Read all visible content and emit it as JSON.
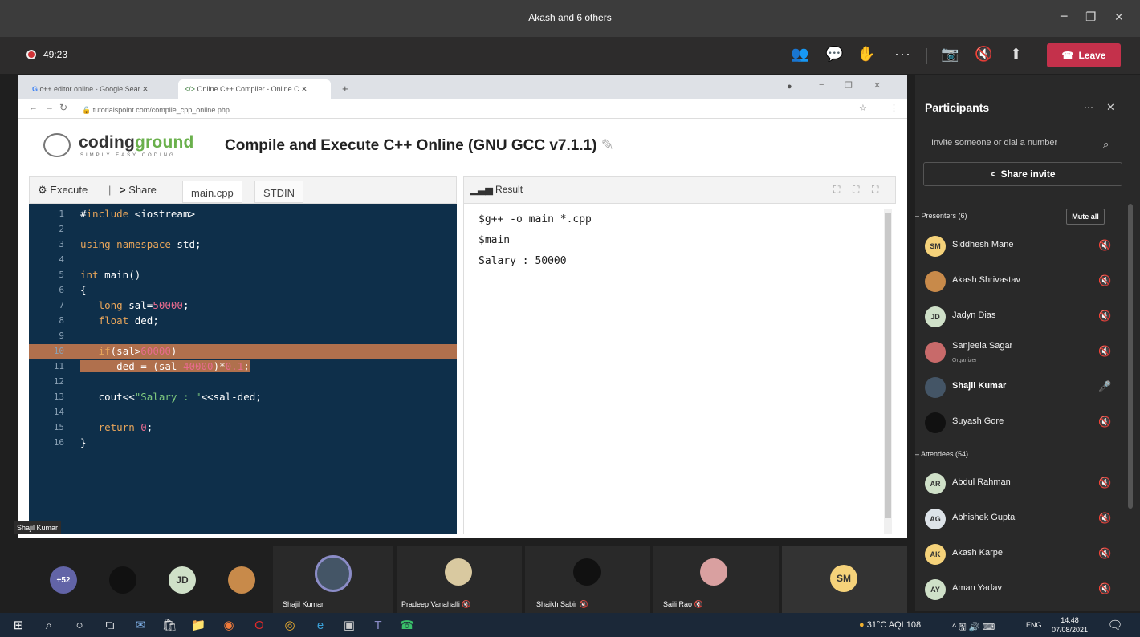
{
  "window": {
    "title": "Akash and 6 others",
    "min": "−",
    "max": "❐",
    "close": "✕"
  },
  "meeting": {
    "timer": "49:23",
    "leave_label": "Leave",
    "icons": [
      "people-icon",
      "chat-icon",
      "reactions-icon",
      "more-icon",
      "camera-off-icon",
      "mic-off-icon",
      "share-tray-icon"
    ]
  },
  "browser": {
    "tabs": [
      "c++ editor online - Google Sear",
      "Online C++ Compiler - Online C"
    ],
    "new_tab": "+",
    "url": "tutorialspoint.com/compile_cpp_online.php"
  },
  "codingground": {
    "logo_main": "coding",
    "logo_accent": "ground",
    "logo_tagline": "SIMPLY EASY CODING",
    "title": "Compile and Execute C++ Online (GNU GCC v7.1.1)",
    "execute": "Execute",
    "sep": "|",
    "share": "Share",
    "file_tab": "main.cpp",
    "stdin_tab": "STDIN",
    "result_label": "Result",
    "result_lines": [
      "$g++ -o main *.cpp",
      "$main",
      "Salary : 50000"
    ]
  },
  "code_lines": [
    {
      "n": "1",
      "t": "#include <iostream>"
    },
    {
      "n": "2",
      "t": ""
    },
    {
      "n": "3",
      "t": "using namespace std;"
    },
    {
      "n": "4",
      "t": ""
    },
    {
      "n": "5",
      "t": "int main()"
    },
    {
      "n": "6",
      "t": "{"
    },
    {
      "n": "7",
      "t": "   long sal=50000;"
    },
    {
      "n": "8",
      "t": "   float ded;"
    },
    {
      "n": "9",
      "t": ""
    },
    {
      "n": "10",
      "t": "   if(sal>60000)"
    },
    {
      "n": "11",
      "t": "      ded = (sal-40000)*0.1;"
    },
    {
      "n": "12",
      "t": ""
    },
    {
      "n": "13",
      "t": "   cout<<\"Salary : \"<<sal-ded;"
    },
    {
      "n": "14",
      "t": ""
    },
    {
      "n": "15",
      "t": "   return 0;"
    },
    {
      "n": "16",
      "t": "}"
    }
  ],
  "presenter_tag": "Shajil Kumar",
  "participants": {
    "title": "Participants",
    "invite_placeholder": "Invite someone or dial a number",
    "share_invite": "Share invite",
    "presenters_label": "Presenters (6)",
    "mute_all": "Mute all",
    "presenters": [
      {
        "initials": "SM",
        "name": "Siddhesh Mane",
        "role": "",
        "color": "#f5d27a"
      },
      {
        "initials": "",
        "name": "Akash Shrivastav",
        "role": "",
        "color": "#c88a4a"
      },
      {
        "initials": "JD",
        "name": "Jadyn Dias",
        "role": "",
        "color": "#cfe0c8"
      },
      {
        "initials": "",
        "name": "Sanjeela Sagar",
        "role": "Organizer",
        "color": "#c86a6a"
      },
      {
        "initials": "",
        "name": "Shajil Kumar",
        "role": "",
        "color": "#445566"
      },
      {
        "initials": "",
        "name": "Suyash Gore",
        "role": "",
        "color": "#111111"
      }
    ],
    "attendees_label": "Attendees (54)",
    "attendees": [
      {
        "initials": "AR",
        "name": "Abdul Rahman",
        "color": "#cfe0c8"
      },
      {
        "initials": "AG",
        "name": "Abhishek Gupta",
        "color": "#dde3e8"
      },
      {
        "initials": "AK",
        "name": "Akash Karpe",
        "color": "#f5d27a"
      },
      {
        "initials": "AY",
        "name": "Aman Yadav",
        "color": "#cfe0c8"
      }
    ]
  },
  "video_strip": {
    "overflow": "+52",
    "jd": "JD",
    "sm": "SM",
    "names": [
      "Shajil Kumar",
      "Pradeep Vanahalli",
      "Shaikh Sabir",
      "Saili Rao"
    ]
  },
  "taskbar": {
    "weather": "31°C  AQI 108",
    "lang": "ENG",
    "time": "14:48",
    "date": "07/08/2021"
  }
}
